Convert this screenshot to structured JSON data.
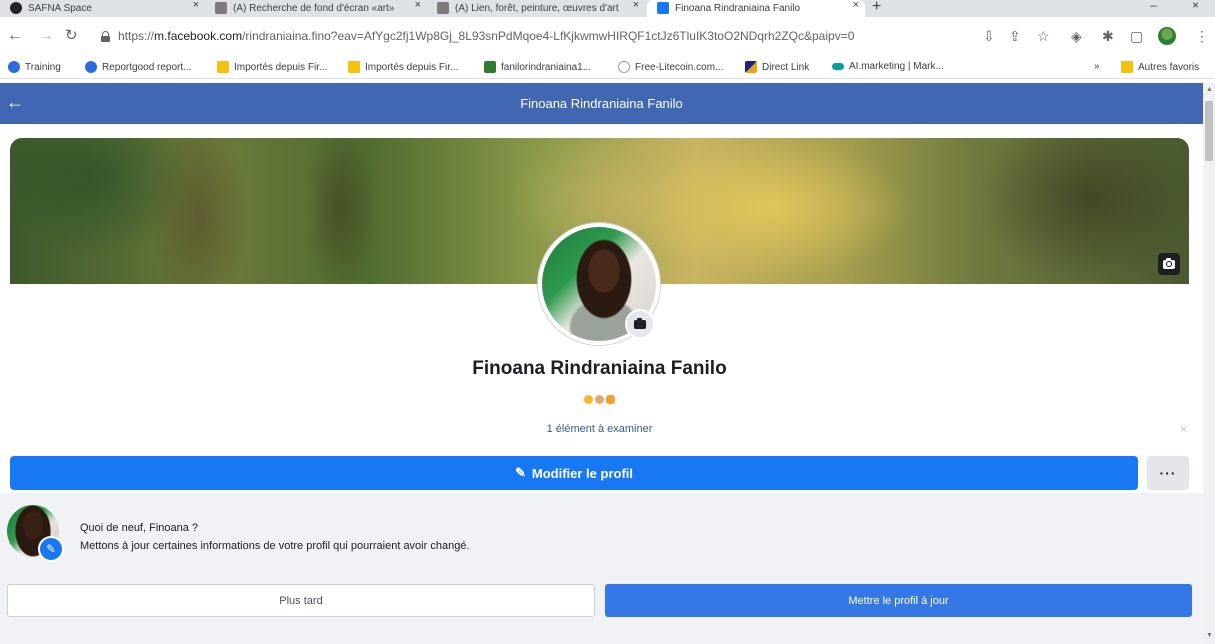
{
  "browser": {
    "tabs": [
      {
        "title": "SAFNA Space"
      },
      {
        "title": "(А) Recherche de fond d'écran «art»"
      },
      {
        "title": "(А) Lien, forêt, peinture, œuvres d'art"
      },
      {
        "title": "Finoana Rindraniaina Fanilo"
      }
    ],
    "url_prefix": "https://",
    "url_host": "m.facebook.com",
    "url_path": "/rindraniaina.fino?eav=AfYgc2fj1Wp8Gj_8L93snPdMqoe4-LfKjkwmwHIRQF1ctJz6TluIK3toO2NDqrh2ZQc&paipv=0",
    "bookmarks": [
      {
        "label": "Training",
        "icon": "reportgood-icon",
        "color": "#2d6cdf"
      },
      {
        "label": "Reportgood report...",
        "icon": "reportgood-icon",
        "color": "#2d6cdf"
      },
      {
        "label": "Importés depuis Fir...",
        "icon": "folder-icon",
        "color": "#f4c20d"
      },
      {
        "label": "Importés depuis Fir...",
        "icon": "folder-icon",
        "color": "#f4c20d"
      },
      {
        "label": "fanilorindraniaina1...",
        "icon": "image-icon",
        "color": "#2e7d32"
      },
      {
        "label": "Free-Litecoin.com...",
        "icon": "litecoin-icon",
        "color": "#9e9e9e"
      },
      {
        "label": "Direct Link",
        "icon": "directlink-icon",
        "color": "#e8a317"
      },
      {
        "label": "AI.marketing | Mark...",
        "icon": "aimarketing-icon",
        "color": "#00a0a0"
      }
    ],
    "bookmarks_more": "»",
    "other_bookmarks": "Autres favoris"
  },
  "header": {
    "title": "Finoana Rindraniaina Fanilo",
    "bg_color": "#4267b2"
  },
  "profile": {
    "name": "Finoana Rindraniaina Fanilo",
    "bio_emojis": [
      "face-emoji",
      "flex-emoji",
      "fist-emoji"
    ],
    "review_link": "1 élément à examiner",
    "edit_button": "Modifier le profil",
    "more_button": "···",
    "accent_color": "#1877f2"
  },
  "update_prompt": {
    "title": "Quoi de neuf, Finoana ?",
    "description": "Mettons à jour certaines informations de votre profil qui pourraient avoir changé.",
    "later_button": "Plus tard",
    "update_button": "Mettre le profil à jour"
  }
}
